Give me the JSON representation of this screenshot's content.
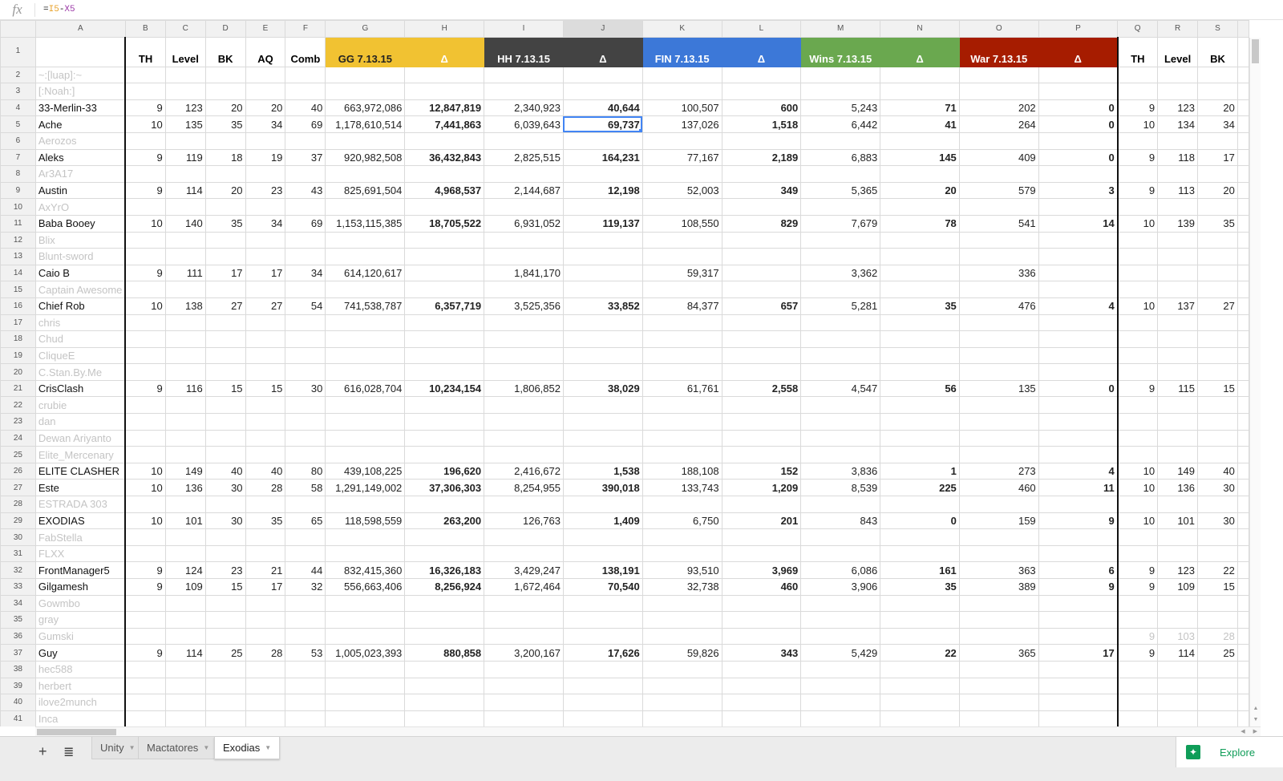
{
  "formula_bar": {
    "icon": "fx-icon",
    "prefix": "=",
    "ref1": "I5",
    "op": "-",
    "ref2": "X5"
  },
  "columns": [
    "A",
    "B",
    "C",
    "D",
    "E",
    "F",
    "G",
    "H",
    "I",
    "J",
    "K",
    "L",
    "M",
    "N",
    "O",
    "P",
    "Q",
    "R",
    "S"
  ],
  "selected_column": "J",
  "selected_cell": "J5",
  "header_row": {
    "row_number": "1",
    "cells": [
      "",
      "TH",
      "Level",
      "BK",
      "AQ",
      "Comb",
      "GG 7.13.15",
      "Δ",
      "HH 7.13.15",
      "Δ",
      "FIN 7.13.15",
      "Δ",
      "Wins 7.13.15",
      "Δ",
      "War 7.13.15",
      "Δ",
      "TH",
      "Level",
      "BK"
    ]
  },
  "header_colors": {
    "gg": "#f1c232",
    "hh": "#434343",
    "fin": "#3c78d8",
    "wins": "#6aa84f",
    "war": "#a61c00"
  },
  "rows": [
    {
      "n": "2",
      "name": "~:[luap]:~",
      "active": false,
      "v": []
    },
    {
      "n": "3",
      "name": "[:Noah:]",
      "active": false,
      "v": []
    },
    {
      "n": "4",
      "name": "33-Merlin-33",
      "active": true,
      "v": [
        "9",
        "123",
        "20",
        "20",
        "40",
        "663,972,086",
        "12,847,819",
        "2,340,923",
        "40,644",
        "100,507",
        "600",
        "5,243",
        "71",
        "202",
        "0",
        "9",
        "123",
        "20"
      ]
    },
    {
      "n": "5",
      "name": "Ache",
      "active": true,
      "v": [
        "10",
        "135",
        "35",
        "34",
        "69",
        "1,178,610,514",
        "7,441,863",
        "6,039,643",
        "69,737",
        "137,026",
        "1,518",
        "6,442",
        "41",
        "264",
        "0",
        "10",
        "134",
        "34"
      ]
    },
    {
      "n": "6",
      "name": "Aerozos",
      "active": false,
      "v": []
    },
    {
      "n": "7",
      "name": "Aleks",
      "active": true,
      "v": [
        "9",
        "119",
        "18",
        "19",
        "37",
        "920,982,508",
        "36,432,843",
        "2,825,515",
        "164,231",
        "77,167",
        "2,189",
        "6,883",
        "145",
        "409",
        "0",
        "9",
        "118",
        "17"
      ]
    },
    {
      "n": "8",
      "name": "Ar3A17",
      "active": false,
      "v": []
    },
    {
      "n": "9",
      "name": "Austin",
      "active": true,
      "v": [
        "9",
        "114",
        "20",
        "23",
        "43",
        "825,691,504",
        "4,968,537",
        "2,144,687",
        "12,198",
        "52,003",
        "349",
        "5,365",
        "20",
        "579",
        "3",
        "9",
        "113",
        "20"
      ]
    },
    {
      "n": "10",
      "name": "AxYrO",
      "active": false,
      "v": []
    },
    {
      "n": "11",
      "name": "Baba Booey",
      "active": true,
      "v": [
        "10",
        "140",
        "35",
        "34",
        "69",
        "1,153,115,385",
        "18,705,522",
        "6,931,052",
        "119,137",
        "108,550",
        "829",
        "7,679",
        "78",
        "541",
        "14",
        "10",
        "139",
        "35"
      ]
    },
    {
      "n": "12",
      "name": "Blix",
      "active": false,
      "v": []
    },
    {
      "n": "13",
      "name": "Blunt-sword",
      "active": false,
      "v": []
    },
    {
      "n": "14",
      "name": "Caio B",
      "active": true,
      "v": [
        "9",
        "111",
        "17",
        "17",
        "34",
        "614,120,617",
        "",
        "1,841,170",
        "",
        "59,317",
        "",
        "3,362",
        "",
        "336",
        "",
        "",
        "",
        ""
      ]
    },
    {
      "n": "15",
      "name": "Captain Awesome",
      "active": false,
      "v": []
    },
    {
      "n": "16",
      "name": "Chief Rob",
      "active": true,
      "v": [
        "10",
        "138",
        "27",
        "27",
        "54",
        "741,538,787",
        "6,357,719",
        "3,525,356",
        "33,852",
        "84,377",
        "657",
        "5,281",
        "35",
        "476",
        "4",
        "10",
        "137",
        "27"
      ]
    },
    {
      "n": "17",
      "name": "chris",
      "active": false,
      "v": []
    },
    {
      "n": "18",
      "name": "Chud",
      "active": false,
      "v": []
    },
    {
      "n": "19",
      "name": "CliqueE",
      "active": false,
      "v": []
    },
    {
      "n": "20",
      "name": "C.Stan.By.Me",
      "active": false,
      "v": []
    },
    {
      "n": "21",
      "name": "CrisClash",
      "active": true,
      "v": [
        "9",
        "116",
        "15",
        "15",
        "30",
        "616,028,704",
        "10,234,154",
        "1,806,852",
        "38,029",
        "61,761",
        "2,558",
        "4,547",
        "56",
        "135",
        "0",
        "9",
        "115",
        "15"
      ]
    },
    {
      "n": "22",
      "name": "crubie",
      "active": false,
      "v": []
    },
    {
      "n": "23",
      "name": "dan",
      "active": false,
      "v": []
    },
    {
      "n": "24",
      "name": "Dewan Ariyanto",
      "active": false,
      "v": []
    },
    {
      "n": "25",
      "name": "Elite_Mercenary",
      "active": false,
      "v": []
    },
    {
      "n": "26",
      "name": "ELITE CLASHER",
      "active": true,
      "v": [
        "10",
        "149",
        "40",
        "40",
        "80",
        "439,108,225",
        "196,620",
        "2,416,672",
        "1,538",
        "188,108",
        "152",
        "3,836",
        "1",
        "273",
        "4",
        "10",
        "149",
        "40"
      ]
    },
    {
      "n": "27",
      "name": "Este",
      "active": true,
      "v": [
        "10",
        "136",
        "30",
        "28",
        "58",
        "1,291,149,002",
        "37,306,303",
        "8,254,955",
        "390,018",
        "133,743",
        "1,209",
        "8,539",
        "225",
        "460",
        "11",
        "10",
        "136",
        "30"
      ]
    },
    {
      "n": "28",
      "name": "ESTRADA 303",
      "active": false,
      "v": []
    },
    {
      "n": "29",
      "name": "EXODIAS",
      "active": true,
      "v": [
        "10",
        "101",
        "30",
        "35",
        "65",
        "118,598,559",
        "263,200",
        "126,763",
        "1,409",
        "6,750",
        "201",
        "843",
        "0",
        "159",
        "9",
        "10",
        "101",
        "30"
      ]
    },
    {
      "n": "30",
      "name": "FabStella",
      "active": false,
      "v": []
    },
    {
      "n": "31",
      "name": "FLXX",
      "active": false,
      "v": []
    },
    {
      "n": "32",
      "name": "FrontManager5",
      "active": true,
      "v": [
        "9",
        "124",
        "23",
        "21",
        "44",
        "832,415,360",
        "16,326,183",
        "3,429,247",
        "138,191",
        "93,510",
        "3,969",
        "6,086",
        "161",
        "363",
        "6",
        "9",
        "123",
        "22"
      ]
    },
    {
      "n": "33",
      "name": "Gilgamesh",
      "active": true,
      "v": [
        "9",
        "109",
        "15",
        "17",
        "32",
        "556,663,406",
        "8,256,924",
        "1,672,464",
        "70,540",
        "32,738",
        "460",
        "3,906",
        "35",
        "389",
        "9",
        "9",
        "109",
        "15"
      ]
    },
    {
      "n": "34",
      "name": "Gowmbo",
      "active": false,
      "v": []
    },
    {
      "n": "35",
      "name": "gray",
      "active": false,
      "v": []
    },
    {
      "n": "36",
      "name": "Gumski",
      "active": false,
      "v": [
        "",
        "",
        "",
        "",
        "",
        "",
        "",
        "",
        "",
        "",
        "",
        "",
        "",
        "",
        "",
        "9",
        "103",
        "28"
      ]
    },
    {
      "n": "37",
      "name": "Guy",
      "active": true,
      "v": [
        "9",
        "114",
        "25",
        "28",
        "53",
        "1,005,023,393",
        "880,858",
        "3,200,167",
        "17,626",
        "59,826",
        "343",
        "5,429",
        "22",
        "365",
        "17",
        "9",
        "114",
        "25"
      ]
    },
    {
      "n": "38",
      "name": "hec588",
      "active": false,
      "v": []
    },
    {
      "n": "39",
      "name": "herbert",
      "active": false,
      "v": []
    },
    {
      "n": "40",
      "name": "ilove2munch",
      "active": false,
      "v": []
    },
    {
      "n": "41",
      "name": "Inca",
      "active": false,
      "v": []
    }
  ],
  "bold_columns": [
    "H",
    "J",
    "L",
    "N",
    "P"
  ],
  "sheet_tabs": [
    {
      "label": "Unity",
      "active": false
    },
    {
      "label": "Mactatores",
      "active": false
    },
    {
      "label": "Exodias",
      "active": true
    }
  ],
  "tabbar": {
    "add_icon": "+",
    "list_icon": "≣"
  },
  "explore": {
    "label": "Explore",
    "color": "#0f9d58"
  }
}
